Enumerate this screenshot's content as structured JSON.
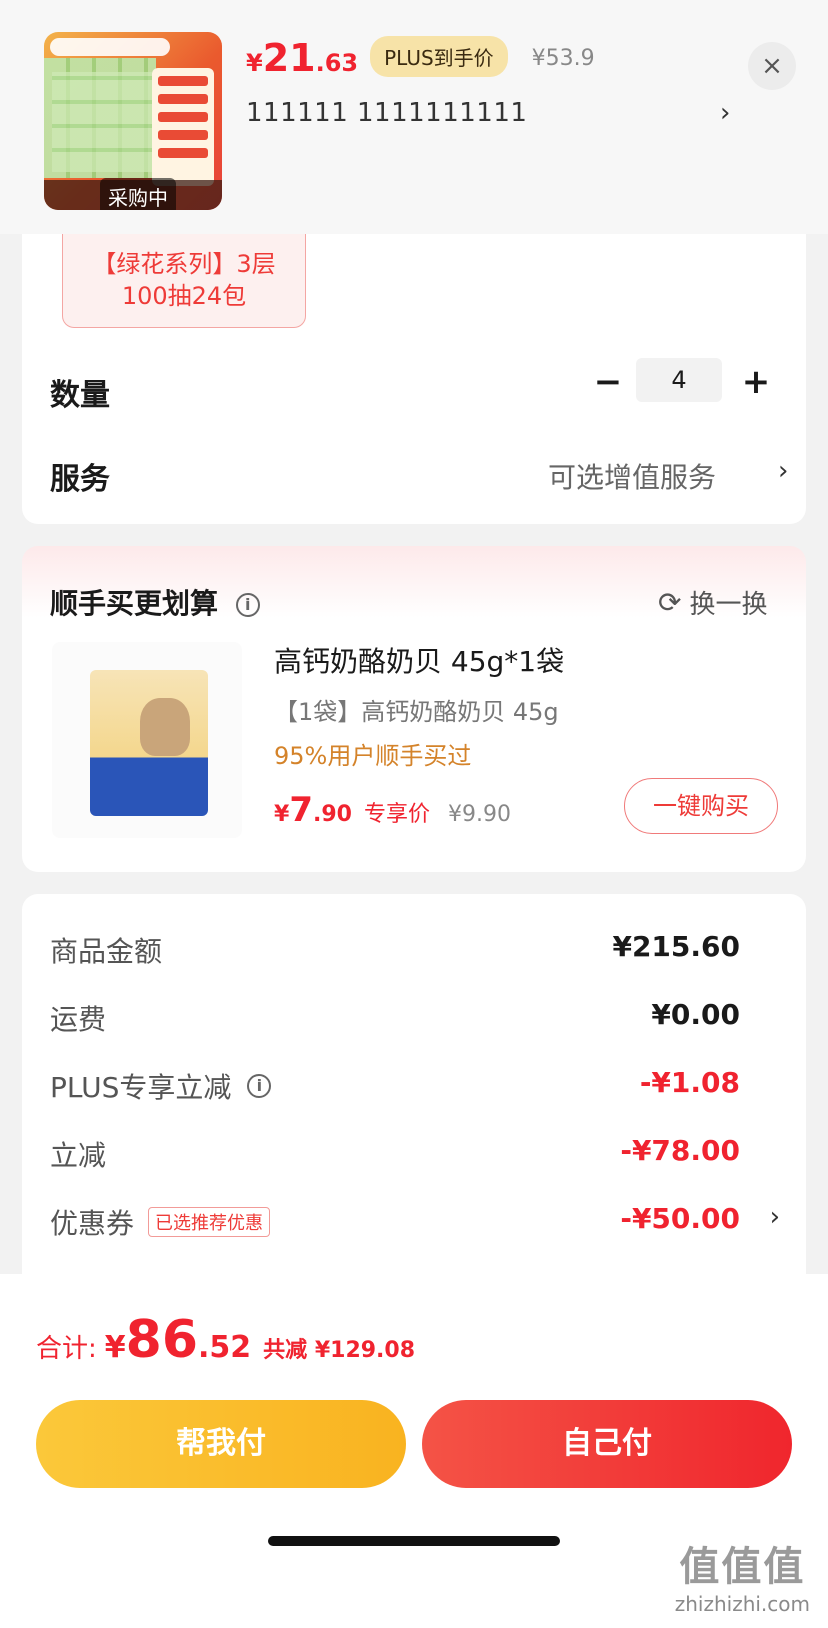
{
  "header": {
    "thumbnail_badge": "采购中",
    "price_yen": "¥",
    "price_int": "21",
    "price_dec": ".63",
    "plus_label": "PLUS到手价",
    "original_price": "¥53.9",
    "spec_text": "111111  1111111111",
    "spec_chevron": "›",
    "close_icon": "×"
  },
  "spec_tile": {
    "line1": "【绿花系列】3层",
    "line2": "100抽24包"
  },
  "quantity": {
    "label": "数量",
    "minus": "−",
    "value": "4",
    "plus": "+"
  },
  "service": {
    "label": "服务",
    "value": "可选增值服务",
    "chevron": "›"
  },
  "addon": {
    "title": "顺手买更划算",
    "info_icon": "i",
    "refresh_icon": "⟳",
    "refresh_label": "换一换",
    "product": {
      "name": "高钙奶酪奶贝 45g*1袋",
      "spec": "【1袋】高钙奶酪奶贝 45g",
      "note": "95%用户顺手买过",
      "price_yen": "¥",
      "price_int": "7",
      "price_dec": ".90",
      "price_tag": "专享价",
      "old_price": "¥9.90",
      "buy_label": "一键购买"
    }
  },
  "fees": {
    "goods_label": "商品金额",
    "goods_value": "¥215.60",
    "shipping_label": "运费",
    "shipping_value": "¥0.00",
    "plus_discount_label": "PLUS专享立减",
    "plus_discount_value": "-¥1.08",
    "discount_label": "立减",
    "discount_value": "-¥78.00",
    "coupon_label": "优惠券",
    "coupon_tag": "已选推荐优惠",
    "coupon_value": "-¥50.00",
    "coupon_chevron": "›"
  },
  "footer": {
    "total_label": "合计:",
    "total_yen": "¥",
    "total_int": "86",
    "total_dec": ".52",
    "total_save": "共减 ¥129.08",
    "help_pay": "帮我付",
    "self_pay": "自己付"
  },
  "watermark": {
    "mark": "值值值",
    "url": "zhizhizhi.com"
  },
  "colors": {
    "accent_red": "#f0232f",
    "help_button": "#f9b320",
    "note_orange": "#d4832a"
  }
}
